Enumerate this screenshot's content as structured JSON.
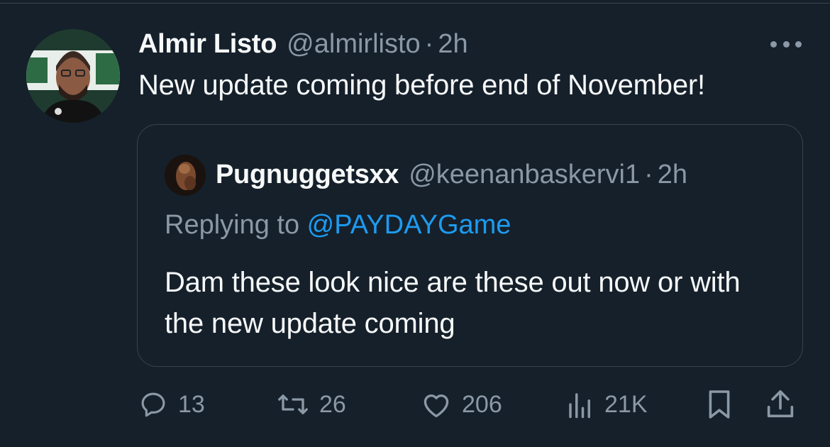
{
  "tweet": {
    "author": {
      "display_name": "Almir Listo",
      "handle": "@almirlisto",
      "time": "2h",
      "separator": "·"
    },
    "text": "New update coming before end of November!",
    "quote": {
      "author": {
        "display_name": "Pugnuggetsxx",
        "handle": "@keenanbaskervi1",
        "time": "2h",
        "separator": "·"
      },
      "replying_prefix": "Replying to ",
      "replying_to": "@PAYDAYGame",
      "text": "Dam these look nice are these out now or with the new update coming"
    },
    "stats": {
      "replies": "13",
      "retweets": "26",
      "likes": "206",
      "views": "21K"
    }
  },
  "icons": {
    "reply": "speech-bubble-icon",
    "retweet": "retweet-arrows-icon",
    "like": "heart-icon",
    "views": "bar-chart-icon",
    "bookmark": "bookmark-icon",
    "share": "share-upload-icon",
    "more": "more-dots-icon"
  },
  "colors": {
    "background": "#15202b",
    "text": "#f7f9f9",
    "muted": "#8b98a5",
    "link": "#1d9bf0",
    "border": "#38444d"
  }
}
